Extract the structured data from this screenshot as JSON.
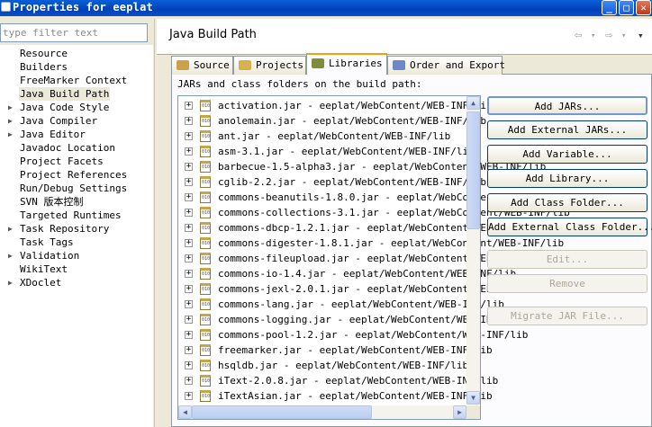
{
  "window": {
    "title": "Properties for eeplat"
  },
  "filter": {
    "placeholder": "type filter text"
  },
  "tree": [
    {
      "label": "Resource",
      "expandable": false
    },
    {
      "label": "Builders",
      "expandable": false
    },
    {
      "label": "FreeMarker Context",
      "expandable": false
    },
    {
      "label": "Java Build Path",
      "expandable": false,
      "selected": true
    },
    {
      "label": "Java Code Style",
      "expandable": true
    },
    {
      "label": "Java Compiler",
      "expandable": true
    },
    {
      "label": "Java Editor",
      "expandable": true
    },
    {
      "label": "Javadoc Location",
      "expandable": false
    },
    {
      "label": "Project Facets",
      "expandable": false
    },
    {
      "label": "Project References",
      "expandable": false
    },
    {
      "label": "Run/Debug Settings",
      "expandable": false
    },
    {
      "label": "SVN 版本控制",
      "expandable": false
    },
    {
      "label": "Targeted Runtimes",
      "expandable": false
    },
    {
      "label": "Task Repository",
      "expandable": true
    },
    {
      "label": "Task Tags",
      "expandable": false
    },
    {
      "label": "Validation",
      "expandable": true
    },
    {
      "label": "WikiText",
      "expandable": false
    },
    {
      "label": "XDoclet",
      "expandable": true
    }
  ],
  "page": {
    "title": "Java Build Path"
  },
  "tabs": [
    {
      "label": "Source",
      "icon": "source-folder-icon",
      "color": "#c9a24a"
    },
    {
      "label": "Projects",
      "icon": "projects-icon",
      "color": "#d8b04e"
    },
    {
      "label": "Libraries",
      "icon": "libraries-icon",
      "color": "#7f8c3a",
      "active": true
    },
    {
      "label": "Order and Export",
      "icon": "order-export-icon",
      "color": "#6b88c9"
    }
  ],
  "libraries": {
    "label": "JARs and class folders on the build path:",
    "jars": [
      "activation.jar - eeplat/WebContent/WEB-INF/lib",
      "anolemain.jar - eeplat/WebContent/WEB-INF/lib",
      "ant.jar - eeplat/WebContent/WEB-INF/lib",
      "asm-3.1.jar - eeplat/WebContent/WEB-INF/lib",
      "barbecue-1.5-alpha3.jar - eeplat/WebContent/WEB-INF/lib",
      "cglib-2.2.jar - eeplat/WebContent/WEB-INF/lib",
      "commons-beanutils-1.8.0.jar - eeplat/WebContent/WEB-INF/lib",
      "commons-collections-3.1.jar - eeplat/WebContent/WEB-INF/lib",
      "commons-dbcp-1.2.1.jar - eeplat/WebContent/WEB-INF/lib",
      "commons-digester-1.8.1.jar - eeplat/WebContent/WEB-INF/lib",
      "commons-fileupload.jar - eeplat/WebContent/WEB-INF/lib",
      "commons-io-1.4.jar - eeplat/WebContent/WEB-INF/lib",
      "commons-jexl-2.0.1.jar - eeplat/WebContent/WEB-INF/lib",
      "commons-lang.jar - eeplat/WebContent/WEB-INF/lib",
      "commons-logging.jar - eeplat/WebContent/WEB-INF/lib",
      "commons-pool-1.2.jar - eeplat/WebContent/WEB-INF/lib",
      "freemarker.jar - eeplat/WebContent/WEB-INF/lib",
      "hsqldb.jar - eeplat/WebContent/WEB-INF/lib",
      "iText-2.0.8.jar - eeplat/WebContent/WEB-INF/lib",
      "iTextAsian.jar - eeplat/WebContent/WEB-INF/lib"
    ]
  },
  "buttons": [
    {
      "label": "Add JARs...",
      "enabled": true,
      "default": true
    },
    {
      "label": "Add External JARs...",
      "enabled": true
    },
    {
      "label": "Add Variable...",
      "enabled": true
    },
    {
      "label": "Add Library...",
      "enabled": true
    },
    {
      "label": "Add Class Folder...",
      "enabled": true
    },
    {
      "label": "Add External Class Folder...",
      "enabled": true
    },
    {
      "label": "Edit...",
      "enabled": false
    },
    {
      "label": "Remove",
      "enabled": false
    },
    {
      "label": "Migrate JAR File...",
      "enabled": false
    }
  ]
}
